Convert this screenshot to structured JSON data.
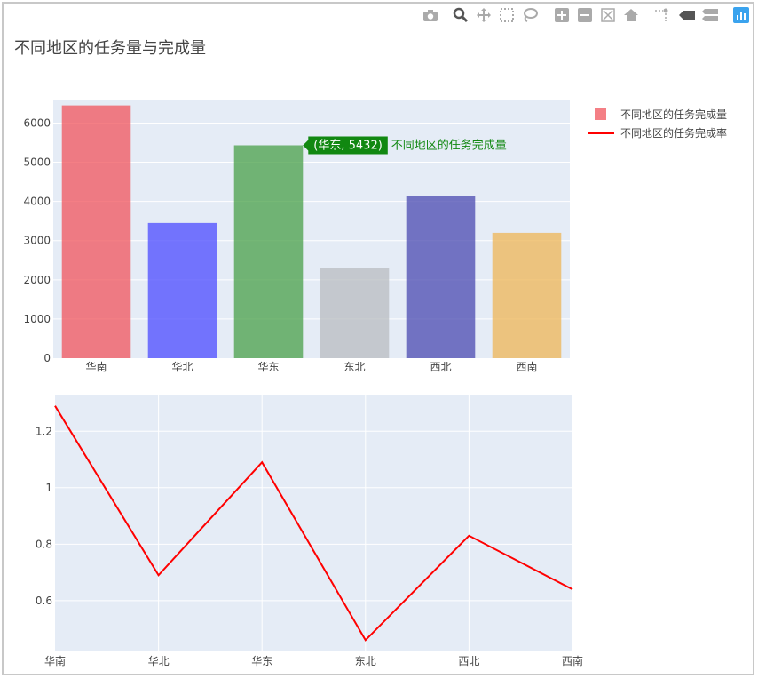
{
  "title": "不同地区的任务量与完成量",
  "modebar": [
    "camera-icon",
    "zoom-icon",
    "pan-icon",
    "box-select-icon",
    "lasso-icon",
    "zoom-in-icon",
    "zoom-out-icon",
    "autoscale-icon",
    "reset-axes-icon",
    "spike-lines-icon",
    "hover-closest-icon",
    "hover-compare-icon",
    "plotly-logo-icon"
  ],
  "legend": {
    "bar_label": "不同地区的任务完成量",
    "line_label": "不同地区的任务完成率"
  },
  "tooltip": {
    "text": "(华东, 5432)",
    "series": "不同地区的任务完成量"
  },
  "chart_data": [
    {
      "type": "bar",
      "categories": [
        "华南",
        "华北",
        "华东",
        "东北",
        "西北",
        "西南"
      ],
      "series": [
        {
          "name": "不同地区的任务完成量",
          "values": [
            6450,
            3450,
            5432,
            2300,
            4150,
            3200
          ]
        }
      ],
      "colors": [
        "#f0545c",
        "#4b4bff",
        "#48a048",
        "#b8bcc0",
        "#4a4ab0",
        "#eeb656"
      ],
      "ylim": [
        0,
        6600
      ],
      "yticks": [
        0,
        1000,
        2000,
        3000,
        4000,
        5000,
        6000
      ],
      "legend_position": "top-right"
    },
    {
      "type": "line",
      "categories": [
        "华南",
        "华北",
        "华东",
        "东北",
        "西北",
        "西南"
      ],
      "series": [
        {
          "name": "不同地区的任务完成率",
          "values": [
            1.29,
            0.69,
            1.09,
            0.46,
            0.83,
            0.64
          ]
        }
      ],
      "color": "#ff0000",
      "ylim": [
        0.42,
        1.33
      ],
      "yticks": [
        0.6,
        0.8,
        1,
        1.2
      ]
    }
  ]
}
